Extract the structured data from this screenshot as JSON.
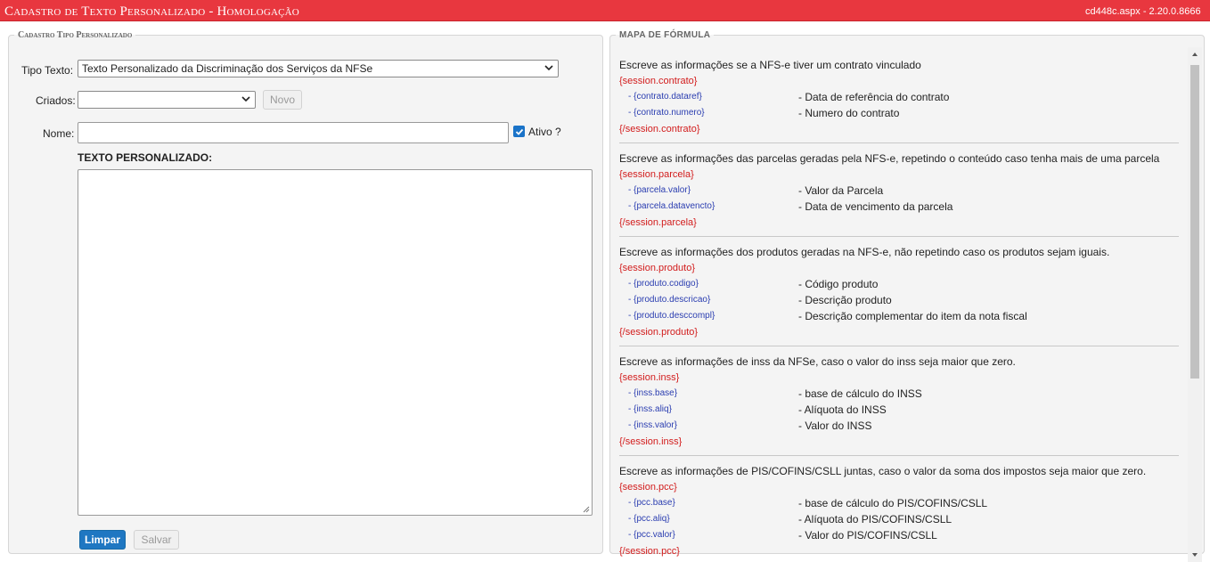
{
  "header": {
    "title": "Cadastro de Texto Personalizado  - Homologação",
    "version": "cd448c.aspx - 2.20.0.8666"
  },
  "left_panel": {
    "legend": "Cadastro Tipo Personalizado",
    "tipo_texto": {
      "label": "Tipo Texto:",
      "value": "Texto Personalizado da Discriminação dos Serviços da NFSe"
    },
    "criados": {
      "label": "Criados:",
      "value": ""
    },
    "novo_button": "Novo",
    "nome": {
      "label": "Nome:",
      "value": ""
    },
    "ativo": {
      "label": "Ativo ?",
      "checked": true
    },
    "texto_label": "TEXTO PERSONALIZADO:",
    "texto_value": "",
    "limpar_button": "Limpar",
    "salvar_button": "Salvar"
  },
  "right_panel": {
    "legend": "MAPA DE FÓRMULA",
    "sections": [
      {
        "desc": "Escreve as informações se a NFS-e tiver um contrato vinculado",
        "open": "{session.contrato}",
        "close": "{/session.contrato}",
        "fields": [
          {
            "field": "- {contrato.dataref}",
            "meaning": "- Data de referência do contrato"
          },
          {
            "field": "- {contrato.numero}",
            "meaning": "- Numero do contrato"
          }
        ]
      },
      {
        "desc": "Escreve as informações das parcelas geradas pela NFS-e, repetindo o conteúdo caso tenha mais de uma parcela",
        "open": "{session.parcela}",
        "close": "{/session.parcela}",
        "fields": [
          {
            "field": "- {parcela.valor}",
            "meaning": "- Valor da Parcela"
          },
          {
            "field": "- {parcela.datavencto}",
            "meaning": "- Data de vencimento da parcela"
          }
        ]
      },
      {
        "desc": "Escreve as informações dos produtos geradas na NFS-e, não repetindo caso os produtos sejam iguais.",
        "open": "{session.produto}",
        "close": "{/session.produto}",
        "fields": [
          {
            "field": "- {produto.codigo}",
            "meaning": "- Código produto"
          },
          {
            "field": "- {produto.descricao}",
            "meaning": "- Descrição produto"
          },
          {
            "field": "- {produto.desccompl}",
            "meaning": "- Descrição complementar do item da nota fiscal"
          }
        ]
      },
      {
        "desc": "Escreve as informações de inss da NFSe, caso o valor do inss seja maior que zero.",
        "open": "{session.inss}",
        "close": "{/session.inss}",
        "fields": [
          {
            "field": "- {inss.base}",
            "meaning": "- base de cálculo do INSS"
          },
          {
            "field": "- {inss.aliq}",
            "meaning": "- Alíquota do INSS"
          },
          {
            "field": "- {inss.valor}",
            "meaning": "- Valor do INSS"
          }
        ]
      },
      {
        "desc": "Escreve as informações de PIS/COFINS/CSLL juntas, caso o valor da soma dos impostos seja maior que zero.",
        "open": "{session.pcc}",
        "close": "{/session.pcc}",
        "fields": [
          {
            "field": "- {pcc.base}",
            "meaning": "- base de cálculo do PIS/COFINS/CSLL"
          },
          {
            "field": "- {pcc.aliq}",
            "meaning": "- Alíquota do PIS/COFINS/CSLL"
          },
          {
            "field": "- {pcc.valor}",
            "meaning": "- Valor do PIS/COFINS/CSLL"
          }
        ]
      }
    ]
  },
  "colors": {
    "header_bg": "#e8373f",
    "primary_button": "#1f77c2",
    "tag_red": "#d21c1c",
    "field_blue": "#2a3db0"
  }
}
